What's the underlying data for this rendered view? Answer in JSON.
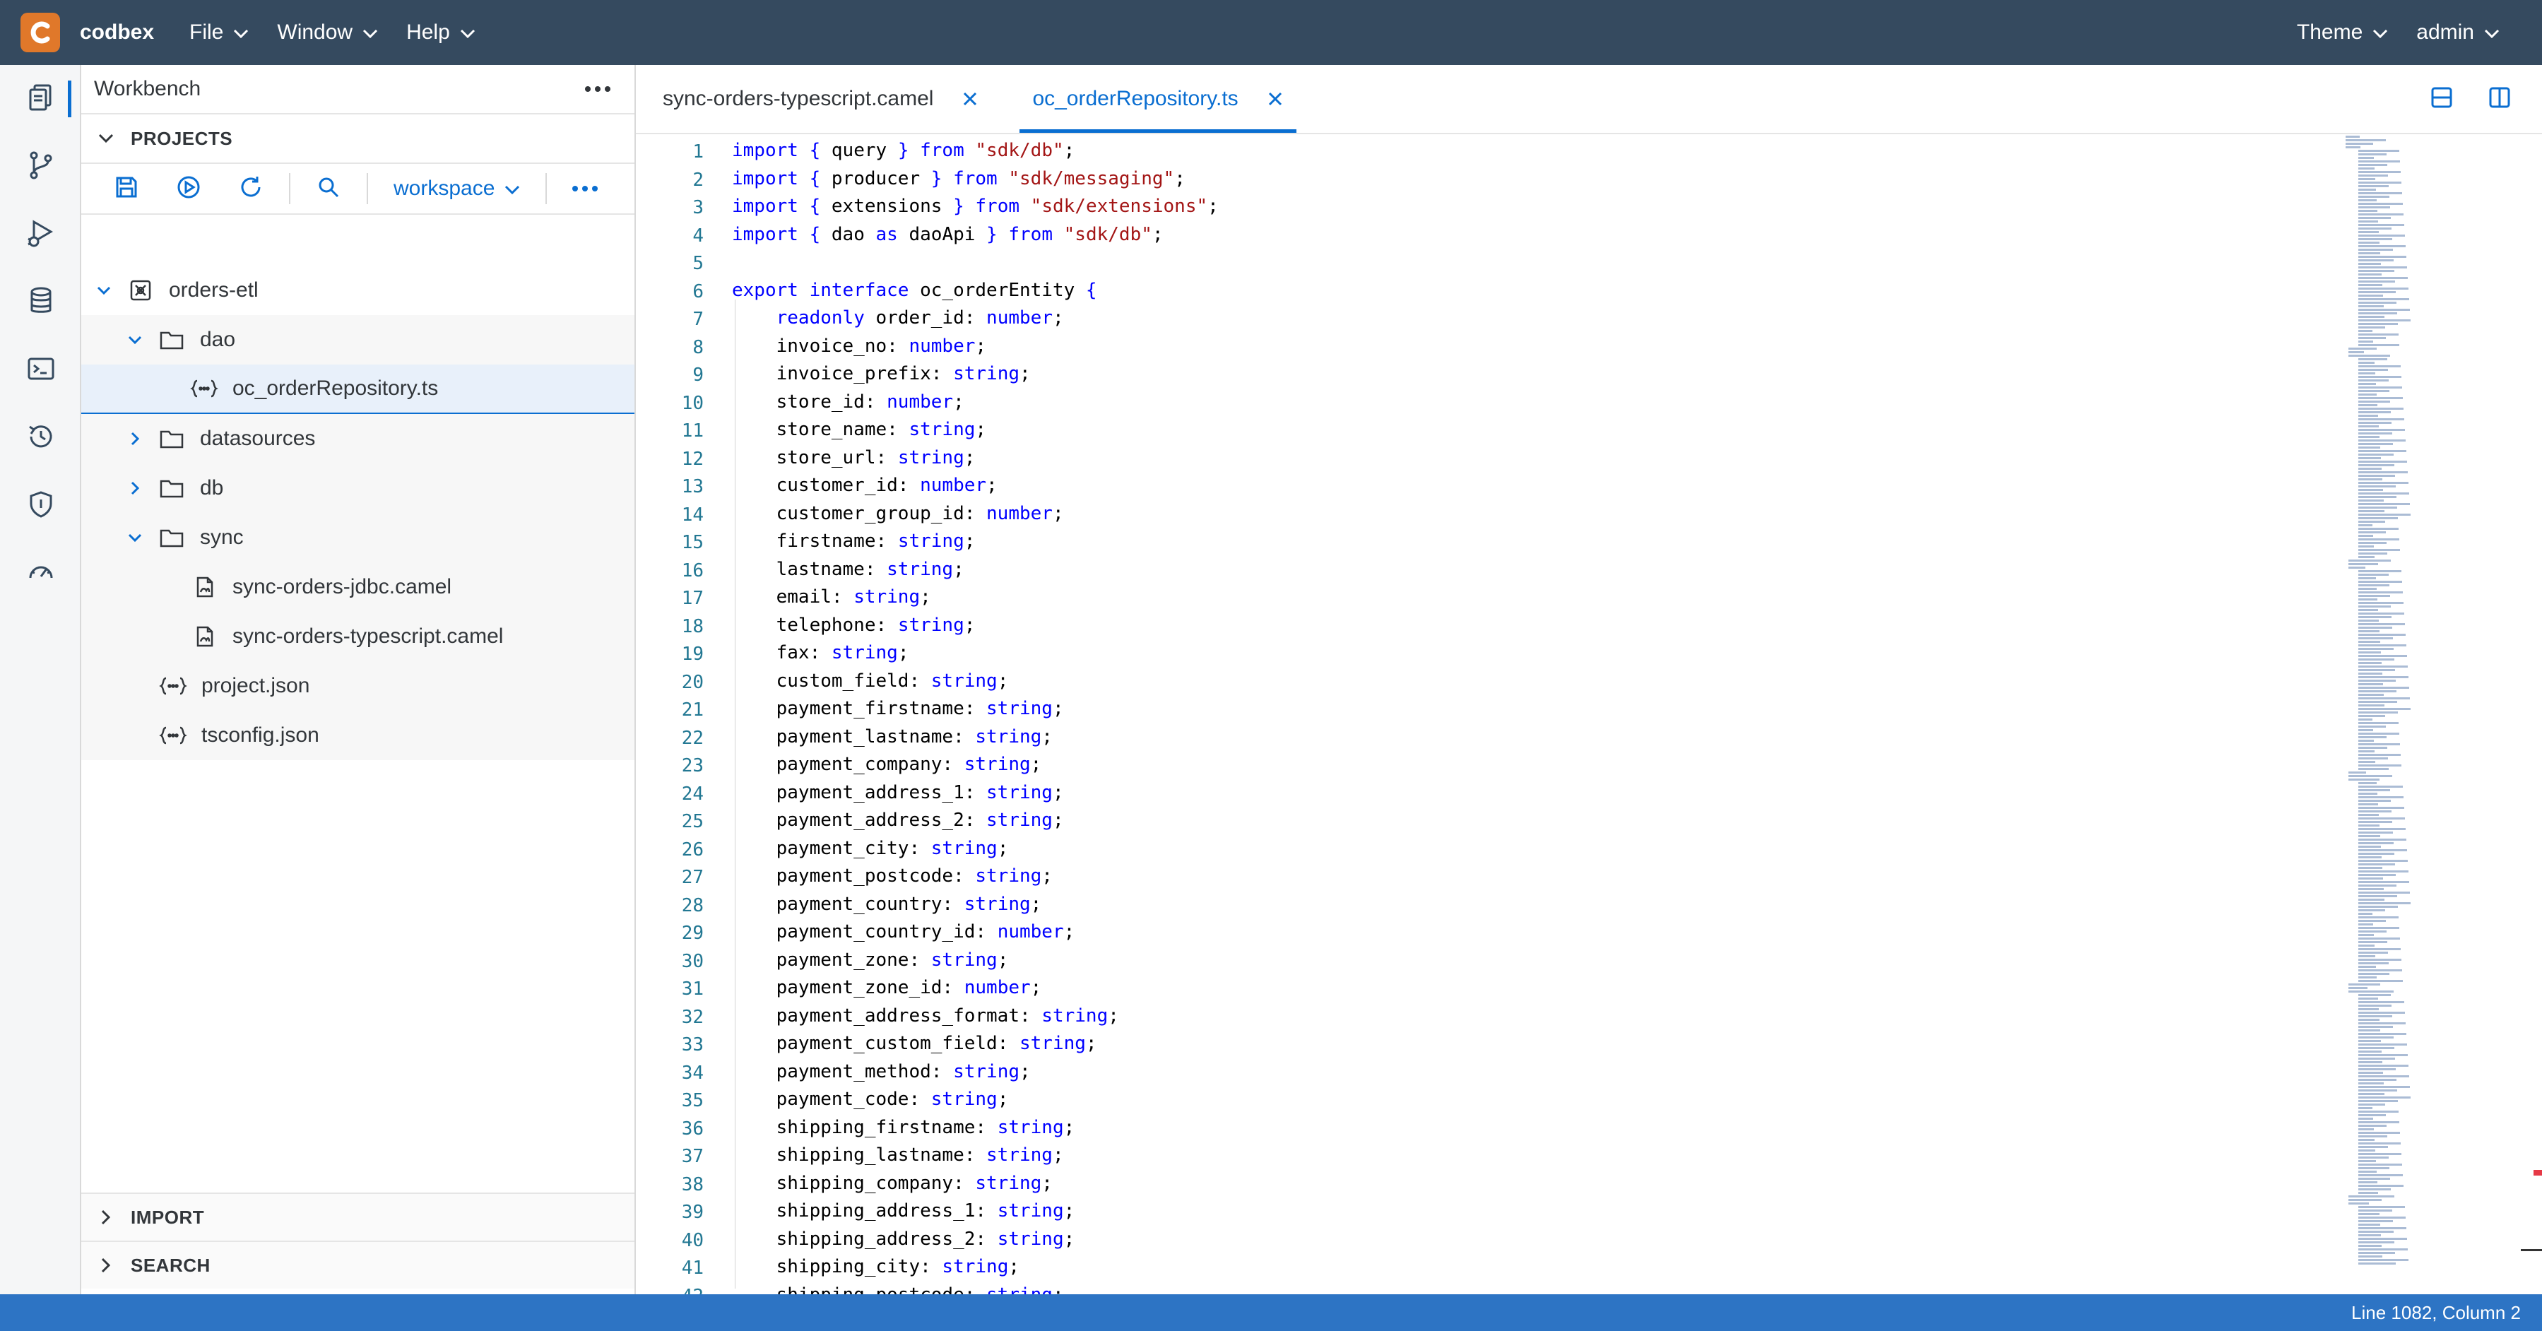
{
  "shell": {
    "brand": "codbex",
    "menus": [
      "File",
      "Window",
      "Help"
    ],
    "theme_label": "Theme",
    "user_label": "admin",
    "colors": {
      "shellbar": "#354a5f",
      "logo": "#e0782a",
      "accent": "#0a6ed1",
      "status": "#2d74c4"
    }
  },
  "activity_bar": {
    "icons": [
      "workbench-icon",
      "git-icon",
      "debug-icon",
      "database-icon",
      "terminal-icon",
      "history-icon",
      "security-icon",
      "gauge-icon"
    ]
  },
  "explorer": {
    "title": "Workbench",
    "projects_label": "PROJECTS",
    "workspace_label": "workspace",
    "tree": [
      {
        "label": "orders-etl",
        "type": "project",
        "expanded": true
      },
      {
        "label": "dao",
        "type": "folder",
        "expanded": true
      },
      {
        "label": "oc_orderRepository.ts",
        "type": "code-file",
        "selected": true
      },
      {
        "label": "datasources",
        "type": "folder",
        "expanded": false
      },
      {
        "label": "db",
        "type": "folder",
        "expanded": false
      },
      {
        "label": "sync",
        "type": "folder",
        "expanded": true
      },
      {
        "label": "sync-orders-jdbc.camel",
        "type": "camel-file"
      },
      {
        "label": "sync-orders-typescript.camel",
        "type": "camel-file"
      },
      {
        "label": "project.json",
        "type": "code-file"
      },
      {
        "label": "tsconfig.json",
        "type": "code-file"
      }
    ],
    "import_label": "IMPORT",
    "search_label": "SEARCH"
  },
  "editor": {
    "tabs": [
      {
        "label": "sync-orders-typescript.camel",
        "active": false
      },
      {
        "label": "oc_orderRepository.ts",
        "active": true
      }
    ],
    "lines": [
      "import { query } from \"sdk/db\";",
      "import { producer } from \"sdk/messaging\";",
      "import { extensions } from \"sdk/extensions\";",
      "import { dao as daoApi } from \"sdk/db\";",
      "",
      "export interface oc_orderEntity {",
      "    readonly order_id: number;",
      "    invoice_no: number;",
      "    invoice_prefix: string;",
      "    store_id: number;",
      "    store_name: string;",
      "    store_url: string;",
      "    customer_id: number;",
      "    customer_group_id: number;",
      "    firstname: string;",
      "    lastname: string;",
      "    email: string;",
      "    telephone: string;",
      "    fax: string;",
      "    custom_field: string;",
      "    payment_firstname: string;",
      "    payment_lastname: string;",
      "    payment_company: string;",
      "    payment_address_1: string;",
      "    payment_address_2: string;",
      "    payment_city: string;",
      "    payment_postcode: string;",
      "    payment_country: string;",
      "    payment_country_id: number;",
      "    payment_zone: string;",
      "    payment_zone_id: number;",
      "    payment_address_format: string;",
      "    payment_custom_field: string;",
      "    payment_method: string;",
      "    payment_code: string;",
      "    shipping_firstname: string;",
      "    shipping_lastname: string;",
      "    shipping_company: string;",
      "    shipping_address_1: string;",
      "    shipping_address_2: string;",
      "    shipping_city: string;",
      "    shipping_postcode: string;"
    ]
  },
  "status": {
    "position": "Line 1082, Column 2"
  }
}
